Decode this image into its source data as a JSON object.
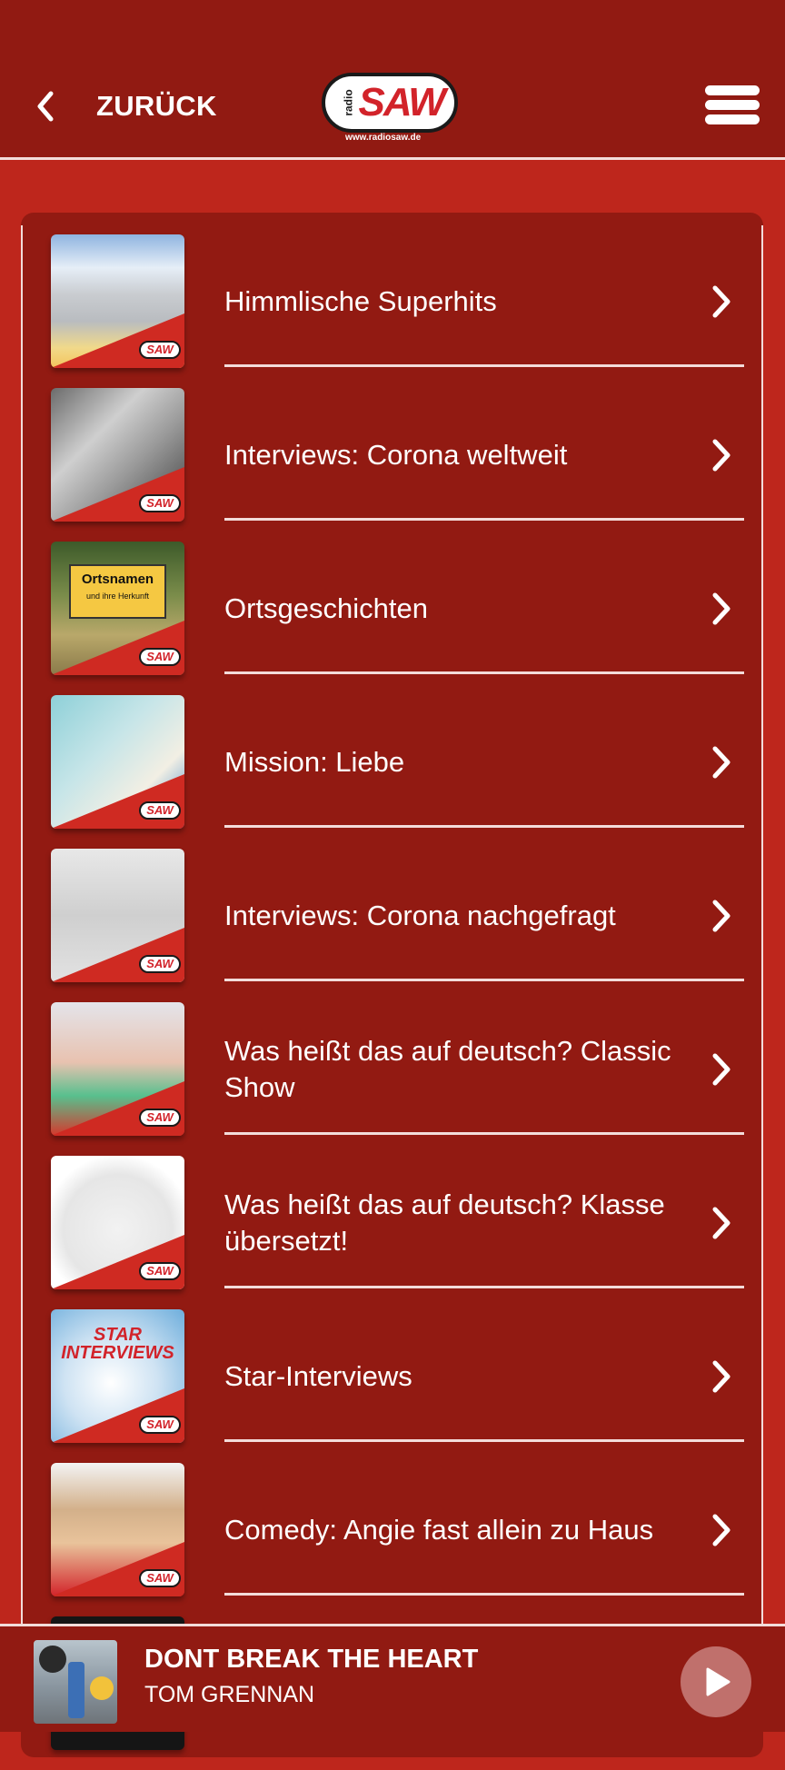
{
  "header": {
    "back_label": "ZURÜCK",
    "logo_small": "radio",
    "logo_main": "SAW",
    "logo_url": "www.radiosaw.de",
    "back_icon": "chevron-left-icon",
    "menu_icon": "hamburger-menu-icon"
  },
  "podcasts": [
    {
      "title": "Himmlische Superhits",
      "thumb": "radio-clouds"
    },
    {
      "title": "Interviews: Corona weltweit",
      "thumb": "virus-microphone"
    },
    {
      "title": "Ortsgeschichten",
      "thumb": "ortsnamen-sign",
      "thumb_text": "Ortsnamen",
      "thumb_subtext": "und ihre Herkunft"
    },
    {
      "title": "Mission: Liebe",
      "thumb": "heart-balloons-woman"
    },
    {
      "title": "Interviews: Corona nachgefragt",
      "thumb": "virus-world-map"
    },
    {
      "title": "Was heißt das auf deutsch? Classic Show",
      "thumb": "man-pons-book"
    },
    {
      "title": "Was heißt das auf deutsch? Klasse übersetzt!",
      "thumb": "man-chalkboard"
    },
    {
      "title": "Star-Interviews",
      "thumb": "star-interviews-mic",
      "thumb_text": "STAR INTERVIEWS"
    },
    {
      "title": "Comedy: Angie fast allein zu Haus",
      "thumb": "caricature"
    }
  ],
  "badge_label": "SAW",
  "player": {
    "title": "DONT BREAK THE HEART",
    "artist": "TOM GRENNAN",
    "play_icon": "play-icon"
  },
  "colors": {
    "background": "#be261c",
    "header": "#911a12",
    "card": "#921a12",
    "brand_red": "#d2232a",
    "divider": "#f3dcda",
    "play_button": "#c0706c"
  }
}
